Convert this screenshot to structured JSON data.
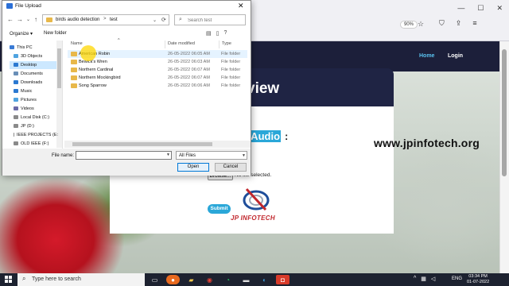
{
  "browser": {
    "zoom": "90%",
    "window_controls": [
      "—",
      "☐",
      "✕"
    ]
  },
  "site": {
    "nav": {
      "home": "Home",
      "login": "Login"
    },
    "card_title": "view",
    "upload_heading": "Upload Audio",
    "upload_colon": ":",
    "browse_label": "Browse...",
    "no_file": "No file selected.",
    "submit_label": "Submit",
    "logo_text": "JP INFOTECH",
    "watermark": "www.jpinfotech.org"
  },
  "dialog": {
    "title": "File Upload",
    "address": {
      "crumbs": [
        "birds audio detection",
        "test"
      ],
      "separator": ">"
    },
    "search_placeholder": "Search test",
    "organize": "Organize ▾",
    "new_folder": "New folder",
    "nav_items": [
      {
        "label": "This PC",
        "icon": "computer-icon",
        "color": "#3a7bd5"
      },
      {
        "label": "3D Objects",
        "icon": "3d-objects-icon",
        "color": "#4fa3e0"
      },
      {
        "label": "Desktop",
        "icon": "desktop-icon",
        "color": "#2b79d1"
      },
      {
        "label": "Documents",
        "icon": "documents-icon",
        "color": "#6a8fb7"
      },
      {
        "label": "Downloads",
        "icon": "downloads-icon",
        "color": "#2b79d1"
      },
      {
        "label": "Music",
        "icon": "music-icon",
        "color": "#2b79d1"
      },
      {
        "label": "Pictures",
        "icon": "pictures-icon",
        "color": "#4fa3e0"
      },
      {
        "label": "Videos",
        "icon": "videos-icon",
        "color": "#6a6aa8"
      },
      {
        "label": "Local Disk (C:)",
        "icon": "drive-icon",
        "color": "#8a8a8a"
      },
      {
        "label": "JP (D:)",
        "icon": "drive-icon",
        "color": "#8a8a8a"
      },
      {
        "label": "IEEE PROJECTS (E:",
        "icon": "drive-icon",
        "color": "#8a8a8a"
      },
      {
        "label": "OLD IEEE (F:)",
        "icon": "drive-icon",
        "color": "#8a8a8a"
      }
    ],
    "selected_nav": "Desktop",
    "columns": {
      "name": "Name",
      "date": "Date modified",
      "type": "Type"
    },
    "files": [
      {
        "name": "American Robin",
        "date": "26-05-2022 06:05 AM",
        "type": "File folder"
      },
      {
        "name": "Bewick's Wren",
        "date": "26-05-2022 06:03 AM",
        "type": "File folder"
      },
      {
        "name": "Northern Cardinal",
        "date": "26-05-2022 06:07 AM",
        "type": "File folder"
      },
      {
        "name": "Northern Mockingbird",
        "date": "26-05-2022 06:07 AM",
        "type": "File folder"
      },
      {
        "name": "Song Sparrow",
        "date": "26-05-2022 06:06 AM",
        "type": "File folder"
      }
    ],
    "file_name_label": "File name:",
    "file_name_value": "",
    "filter": "All Files",
    "open_label": "Open",
    "cancel_label": "Cancel"
  },
  "taskbar": {
    "search_placeholder": "Type here to search",
    "lang": "ENG",
    "time": "03:34 PM",
    "date": "01-07-2022"
  }
}
